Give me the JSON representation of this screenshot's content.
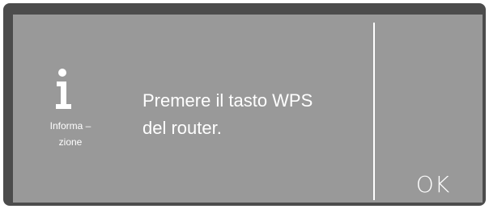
{
  "dialog": {
    "icon": "info-icon",
    "icon_label_line1": "Informa –",
    "icon_label_line2": "zione",
    "message_line1": "Premere il tasto WPS",
    "message_line2": "del router.",
    "ok_label": "OK"
  },
  "colors": {
    "bezel": "#4c4c4c",
    "panel": "#999999",
    "text": "#ffffff",
    "divider": "#ffffff"
  }
}
